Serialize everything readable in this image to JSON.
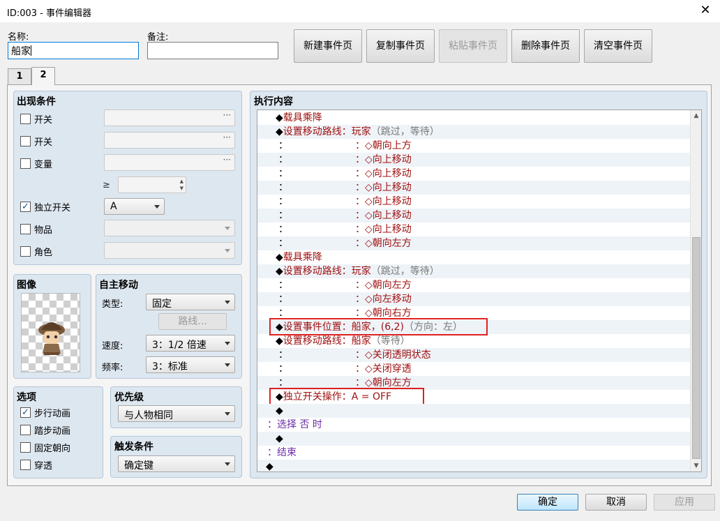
{
  "window": {
    "title": "ID:003 - 事件编辑器"
  },
  "header": {
    "name_label": "名称:",
    "name_value": "船家",
    "note_label": "备注:",
    "note_value": "",
    "buttons": {
      "new_page": "新建事件页",
      "copy_page": "复制事件页",
      "paste_page": "粘贴事件页",
      "delete_page": "删除事件页",
      "clear_page": "清空事件页"
    }
  },
  "tabs": [
    {
      "label": "1",
      "active": false
    },
    {
      "label": "2",
      "active": true
    }
  ],
  "conditions": {
    "title": "出现条件",
    "switch1_label": "开关",
    "switch1_value": "",
    "switch1_checked": false,
    "switch2_label": "开关",
    "switch2_value": "",
    "switch2_checked": false,
    "variable_label": "变量",
    "variable_value": "",
    "variable_checked": false,
    "compare_symbol": "≥",
    "self_switch_label": "独立开关",
    "self_switch_checked": true,
    "self_switch_value": "A",
    "item_label": "物品",
    "item_checked": false,
    "actor_label": "角色",
    "actor_checked": false,
    "browse_glyph": "···"
  },
  "image": {
    "title": "图像"
  },
  "autonomous": {
    "title": "自主移动",
    "type_label": "类型:",
    "type_value": "固定",
    "route_button": "路线...",
    "speed_label": "速度:",
    "speed_value": "3：1/2 倍速",
    "freq_label": "频率:",
    "freq_value": "3：标准"
  },
  "options": {
    "title": "选项",
    "walking_label": "步行动画",
    "walking_checked": true,
    "stepping_label": "踏步动画",
    "stepping_checked": false,
    "fixed_label": "固定朝向",
    "fixed_checked": false,
    "through_label": "穿透",
    "through_checked": false
  },
  "priority": {
    "title": "优先级",
    "value": "与人物相同"
  },
  "trigger": {
    "title": "触发条件",
    "value": "确定键"
  },
  "contents": {
    "title": "执行内容",
    "lines": [
      {
        "indent": 26,
        "parts": [
          {
            "t": "◆",
            "c": "black"
          },
          {
            "t": "载具乘降",
            "c": "red"
          }
        ]
      },
      {
        "indent": 26,
        "parts": [
          {
            "t": "◆",
            "c": "black"
          },
          {
            "t": "设置移动路线：玩家",
            "c": "red"
          },
          {
            "t": "（跳过，等待）",
            "c": "gray"
          }
        ]
      },
      {
        "indent": 30,
        "parts": [
          {
            "t": "：",
            "c": "black"
          }
        ],
        "cont": "：◇朝向上方"
      },
      {
        "indent": 30,
        "parts": [
          {
            "t": "：",
            "c": "black"
          }
        ],
        "cont": "：◇向上移动"
      },
      {
        "indent": 30,
        "parts": [
          {
            "t": "：",
            "c": "black"
          }
        ],
        "cont": "：◇向上移动"
      },
      {
        "indent": 30,
        "parts": [
          {
            "t": "：",
            "c": "black"
          }
        ],
        "cont": "：◇向上移动"
      },
      {
        "indent": 30,
        "parts": [
          {
            "t": "：",
            "c": "black"
          }
        ],
        "cont": "：◇向上移动"
      },
      {
        "indent": 30,
        "parts": [
          {
            "t": "：",
            "c": "black"
          }
        ],
        "cont": "：◇向上移动"
      },
      {
        "indent": 30,
        "parts": [
          {
            "t": "：",
            "c": "black"
          }
        ],
        "cont": "：◇向上移动"
      },
      {
        "indent": 30,
        "parts": [
          {
            "t": "：",
            "c": "black"
          }
        ],
        "cont": "：◇朝向左方"
      },
      {
        "indent": 26,
        "parts": [
          {
            "t": "◆",
            "c": "black"
          },
          {
            "t": "载具乘降",
            "c": "red"
          }
        ]
      },
      {
        "indent": 26,
        "parts": [
          {
            "t": "◆",
            "c": "black"
          },
          {
            "t": "设置移动路线：玩家",
            "c": "red"
          },
          {
            "t": "（跳过，等待）",
            "c": "gray"
          }
        ]
      },
      {
        "indent": 30,
        "parts": [
          {
            "t": "：",
            "c": "black"
          }
        ],
        "cont": "：◇朝向左方"
      },
      {
        "indent": 30,
        "parts": [
          {
            "t": "：",
            "c": "black"
          }
        ],
        "cont": "：◇向左移动"
      },
      {
        "indent": 30,
        "parts": [
          {
            "t": "：",
            "c": "black"
          }
        ],
        "cont": "：◇朝向右方"
      },
      {
        "indent": 26,
        "parts": [
          {
            "t": "◆",
            "c": "black"
          },
          {
            "t": "设置事件位置：船家，(6,2)",
            "c": "red"
          },
          {
            "t": "（方向：左）",
            "c": "gray"
          }
        ],
        "highlight": true
      },
      {
        "indent": 26,
        "parts": [
          {
            "t": "◆",
            "c": "black"
          },
          {
            "t": "设置移动路线：船家",
            "c": "red"
          },
          {
            "t": "（等待）",
            "c": "gray"
          }
        ]
      },
      {
        "indent": 30,
        "parts": [
          {
            "t": "：",
            "c": "black"
          }
        ],
        "cont": "：◇关闭透明状态"
      },
      {
        "indent": 30,
        "parts": [
          {
            "t": "：",
            "c": "black"
          }
        ],
        "cont": "：◇关闭穿透"
      },
      {
        "indent": 30,
        "parts": [
          {
            "t": "：",
            "c": "black"
          }
        ],
        "cont": "：◇朝向左方"
      },
      {
        "indent": 26,
        "parts": [
          {
            "t": "◆",
            "c": "black"
          },
          {
            "t": "独立开关操作：A = OFF",
            "c": "red"
          }
        ],
        "highlight": true
      },
      {
        "indent": 26,
        "parts": [
          {
            "t": "◆",
            "c": "black"
          }
        ]
      },
      {
        "indent": 14,
        "parts": [
          {
            "t": "：选择 否 时",
            "c": "purple"
          }
        ]
      },
      {
        "indent": 26,
        "parts": [
          {
            "t": "◆",
            "c": "black"
          }
        ]
      },
      {
        "indent": 14,
        "parts": [
          {
            "t": "：结束",
            "c": "purple"
          }
        ]
      },
      {
        "indent": 12,
        "parts": [
          {
            "t": "◆",
            "c": "black"
          }
        ]
      }
    ]
  },
  "footer": {
    "ok": "确定",
    "cancel": "取消",
    "apply": "应用"
  },
  "colors": {
    "red": "#a01010",
    "gray": "#777777",
    "purple": "#6a2da8",
    "black": "#000000",
    "highlight": "#e02020"
  },
  "icons": {
    "close": "close-icon",
    "check": "check-icon",
    "dropdown": "chevron-down-icon",
    "scroll_up": "scroll-up-icon",
    "scroll_down": "scroll-down-icon"
  }
}
